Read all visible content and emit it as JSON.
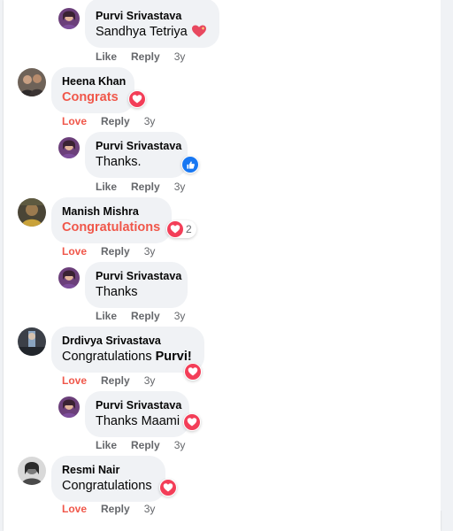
{
  "colors": {
    "love": "#f0574a",
    "heart_badge": "#f33e58",
    "like_badge": "#1877f2",
    "bubble": "#f0f2f5",
    "meta": "#65676b"
  },
  "comments": [
    {
      "author": "Purvi Srivastava",
      "text": "Sandhya Tetriya",
      "text_emoji": "sparkling-heart",
      "actions": [
        "Like",
        "Reply"
      ],
      "age": "3y"
    },
    {
      "author": "Heena Khan",
      "text": "Congrats",
      "reaction": "love",
      "actions": [
        "Love",
        "Reply"
      ],
      "age": "3y"
    },
    {
      "author": "Purvi Srivastava",
      "text": "Thanks.",
      "reaction": "like",
      "actions": [
        "Like",
        "Reply"
      ],
      "age": "3y"
    },
    {
      "author": "Manish Mishra",
      "text": "Congratulations",
      "reaction": "love",
      "reaction_count": "2",
      "actions": [
        "Love",
        "Reply"
      ],
      "age": "3y"
    },
    {
      "author": "Purvi Srivastava",
      "text": "Thanks",
      "actions": [
        "Like",
        "Reply"
      ],
      "age": "3y"
    },
    {
      "author": "Drdivya Srivastava",
      "text": "Congratulations ",
      "mention": "Purvi!",
      "reaction": "love",
      "actions": [
        "Love",
        "Reply"
      ],
      "age": "3y"
    },
    {
      "author": "Purvi Srivastava",
      "text": "Thanks Maami",
      "reaction": "love",
      "actions": [
        "Like",
        "Reply"
      ],
      "age": "3y"
    },
    {
      "author": "Resmi Nair",
      "text": "Congratulations",
      "reaction": "love",
      "actions": [
        "Love",
        "Reply"
      ],
      "age": "3y"
    }
  ]
}
